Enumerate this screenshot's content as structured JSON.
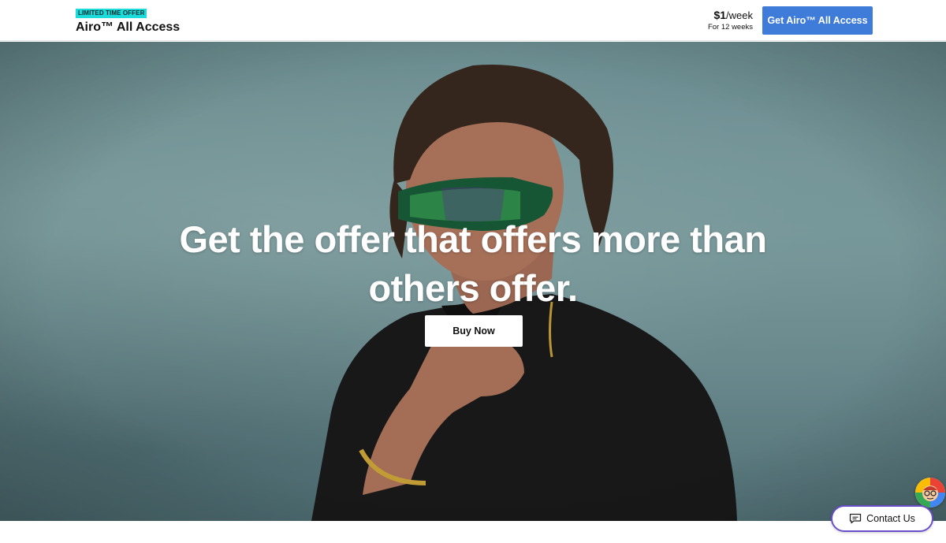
{
  "header": {
    "badge": "LIMITED TIME OFFER",
    "title": "Airo™ All Access",
    "price_amount": "$1",
    "price_unit": "/week",
    "price_term": "For 12 weeks",
    "cta_label": "Get Airo™ All Access"
  },
  "hero": {
    "headline_line1": "Get the offer that offers more than",
    "headline_line2": "others offer.",
    "button_label": "Buy Now"
  },
  "widgets": {
    "contact_label": "Contact Us",
    "chat_icon": "chat-bubble-icon",
    "assistant_icon": "assistant-avatar"
  },
  "colors": {
    "badge_bg": "#1bdbdb",
    "cta_bg": "#3f7bd9",
    "contact_border": "#6a4fc9",
    "hero_bg": "#7ea1a3"
  }
}
